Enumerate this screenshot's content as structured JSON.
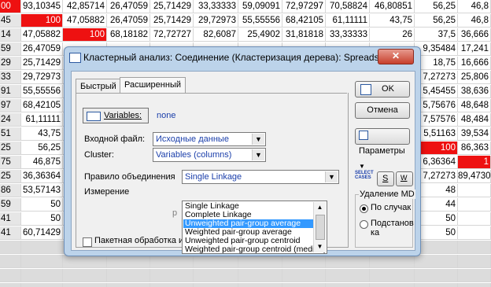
{
  "spreadsheet": {
    "rows": [
      {
        "idx": "00",
        "idx_red": true,
        "cells": [
          "93,10345",
          "42,85714",
          "26,47059",
          "25,71429",
          "33,33333",
          "59,09091",
          "72,97297",
          "70,58824",
          "46,80851",
          "56,25",
          "46,8"
        ],
        "red": []
      },
      {
        "idx": "45",
        "cells": [
          "100",
          "47,05882",
          "26,47059",
          "25,71429",
          "29,72973",
          "55,55556",
          "68,42105",
          "61,11111",
          "43,75",
          "56,25",
          "46,8"
        ],
        "red": [
          0
        ]
      },
      {
        "idx": "14",
        "cells": [
          "47,05882",
          "100",
          "68,18182",
          "72,72727",
          "82,6087",
          "25,4902",
          "31,81818",
          "33,33333",
          "26",
          "37,5",
          "36,666"
        ],
        "red": [
          1
        ]
      },
      {
        "idx": "59",
        "cells": [
          "26,47059",
          "",
          "",
          "",
          "",
          "",
          "",
          "",
          "",
          "9,35484",
          "17,241"
        ],
        "red": []
      },
      {
        "idx": "29",
        "cells": [
          "25,71429",
          "",
          "",
          "",
          "",
          "",
          "",
          "",
          "",
          "18,75",
          "16,666"
        ],
        "red": []
      },
      {
        "idx": "33",
        "cells": [
          "29,72973",
          "",
          "",
          "",
          "",
          "",
          "",
          "",
          "",
          "7,27273",
          "25,806"
        ],
        "red": []
      },
      {
        "idx": "91",
        "cells": [
          "55,55556",
          "",
          "",
          "",
          "",
          "",
          "",
          "",
          "",
          "5,45455",
          "38,636"
        ],
        "red": []
      },
      {
        "idx": "97",
        "cells": [
          "68,42105",
          "",
          "",
          "",
          "",
          "",
          "",
          "",
          "",
          "5,75676",
          "48,648"
        ],
        "red": []
      },
      {
        "idx": "24",
        "cells": [
          "61,11111",
          "",
          "",
          "",
          "",
          "",
          "",
          "",
          "",
          "7,57576",
          "48,484"
        ],
        "red": []
      },
      {
        "idx": "51",
        "cells": [
          "43,75",
          "",
          "",
          "",
          "",
          "",
          "",
          "",
          "",
          "5,51163",
          "39,534"
        ],
        "red": []
      },
      {
        "idx": "25",
        "cells": [
          "56,25",
          "",
          "",
          "",
          "",
          "",
          "",
          "",
          "",
          "100",
          "86,363"
        ],
        "red": [
          9
        ]
      },
      {
        "idx": "75",
        "cells": [
          "46,875",
          "",
          "",
          "",
          "",
          "",
          "",
          "",
          "",
          "6,36364",
          "1"
        ],
        "red": [
          10
        ]
      },
      {
        "idx": "25",
        "cells": [
          "36,36364",
          "",
          "",
          "",
          "",
          "",
          "",
          "",
          "",
          "7,27273",
          "89,4730"
        ],
        "red": []
      },
      {
        "idx": "86",
        "cells": [
          "53,57143",
          "",
          "",
          "",
          "",
          "",
          "",
          "",
          "",
          "48",
          ""
        ],
        "red": []
      },
      {
        "idx": "59",
        "cells": [
          "50",
          "",
          "",
          "",
          "",
          "",
          "",
          "",
          "",
          "44",
          ""
        ],
        "red": []
      },
      {
        "idx": "41",
        "cells": [
          "50",
          "",
          "",
          "",
          "",
          "",
          "",
          "",
          "",
          "50",
          ""
        ],
        "red": []
      },
      {
        "idx": "41",
        "cells": [
          "60,71429",
          "",
          "",
          "",
          "",
          "",
          "",
          "",
          "",
          "50",
          ""
        ],
        "red": []
      }
    ]
  },
  "dialog": {
    "title": "Кластерный анализ: Соединение (Кластеризация дерева): Spreadsheet1",
    "close_label": "✕",
    "tabs": [
      "Быстрый",
      "Расширенный"
    ],
    "variables_label": "Variables:",
    "variables_value": "none",
    "input_file_label": "Входной файл:",
    "input_file_value": "Исходные данные",
    "cluster_label": "Cluster:",
    "cluster_value": "Variables (columns)",
    "linkage_label": "Правило объединения",
    "linkage_value": "Single Linkage",
    "linkage_options": [
      "Single Linkage",
      "Complete Linkage",
      "Unweighted pair-group average",
      "Weighted pair-group average",
      "Unweighted pair-group centroid",
      "Weighted pair-group centroid (median)"
    ],
    "linkage_selected_index": 2,
    "distance_label": "Измерение",
    "hidden_p_label": "р",
    "batch_label": "Пакетная обработка и сс",
    "ok_label": "OK",
    "cancel_label": "Отмена",
    "params_label": "Параметры",
    "select_cases_label": "SELECT CASES",
    "s_label": "S",
    "w_label": "W",
    "md_group_label": "Удаление MD",
    "md_option_1": "По случак",
    "md_option_2": "Подстанов ка",
    "md_selected": 1
  }
}
